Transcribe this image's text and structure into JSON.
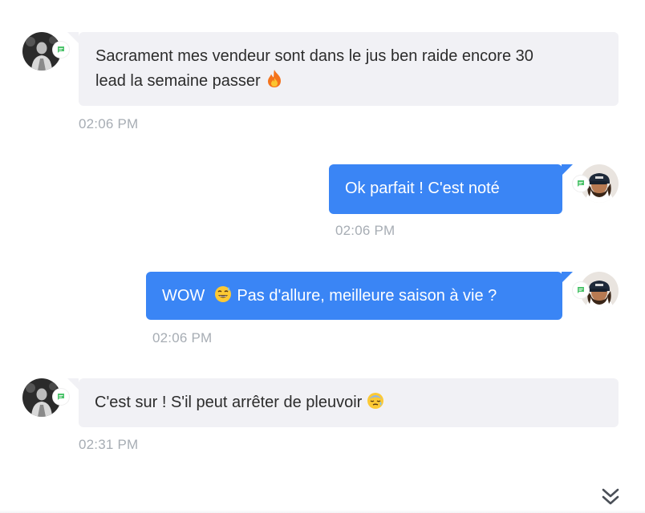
{
  "messages": [
    {
      "direction": "incoming",
      "avatar_icon": "user-avatar-grayscale",
      "channel_icon": "chat-bubble-icon",
      "line1": "Sacrament mes vendeur sont dans le jus ben raide encore 30",
      "line2": "lead la semaine passer",
      "emoji": "fire-emoji",
      "time": "02:06 PM"
    },
    {
      "direction": "outgoing",
      "avatar_icon": "agent-avatar-cap",
      "channel_icon": "chat-bubble-icon",
      "text": "Ok parfait ! C'est noté",
      "time": "02:06 PM"
    },
    {
      "direction": "outgoing",
      "avatar_icon": "agent-avatar-cap",
      "channel_icon": "chat-bubble-icon",
      "text_before": "WOW",
      "emoji": "grinning-sweat-emoji",
      "text_after": "Pas d'allure, meilleure saison à vie ?",
      "time": "02:06 PM"
    },
    {
      "direction": "incoming",
      "avatar_icon": "user-avatar-grayscale",
      "channel_icon": "chat-bubble-icon",
      "text": "C'est sur ! S'il peut arrêter de pleuvoir",
      "emoji": "downcast-sweat-emoji",
      "time": "02:31 PM"
    }
  ],
  "scroll_button": {
    "icon": "double-chevron-down-icon"
  },
  "colors": {
    "incoming_bubble": "#f1f1f5",
    "outgoing_bubble": "#3a85f5",
    "timestamp": "#a7adb4",
    "channel_badge": "#4cc36b"
  }
}
